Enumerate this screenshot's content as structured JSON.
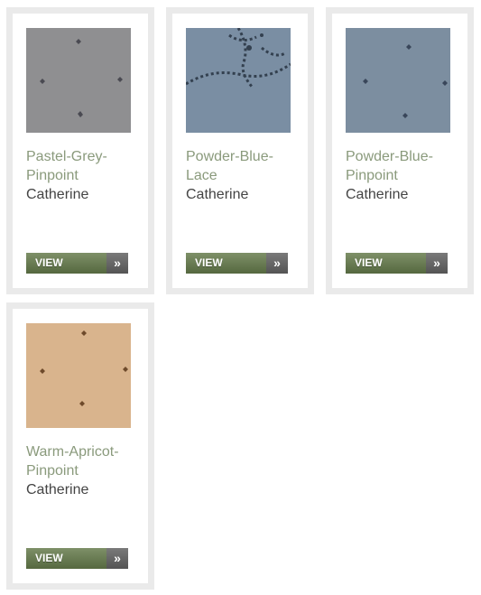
{
  "products": [
    {
      "name": "Pastel-Grey-Pinpoint",
      "collection": "Catherine",
      "button_label": "VIEW",
      "button_arrow": "»",
      "swatch": {
        "pattern": "pinpoint",
        "base": "#8a898c",
        "mark": "#4a4a52"
      }
    },
    {
      "name": "Powder-Blue-Lace",
      "collection": "Catherine",
      "button_label": "VIEW",
      "button_arrow": "»",
      "swatch": {
        "pattern": "lace",
        "base": "#7a8ea3",
        "mark": "#33404f"
      }
    },
    {
      "name": "Powder-Blue-Pinpoint",
      "collection": "Catherine",
      "button_label": "VIEW",
      "button_arrow": "»",
      "swatch": {
        "pattern": "pinpoint",
        "base": "#7c8ea0",
        "mark": "#39465a"
      }
    },
    {
      "name": "Warm-Apricot-Pinpoint",
      "collection": "Catherine",
      "button_label": "VIEW",
      "button_arrow": "»",
      "swatch": {
        "pattern": "pinpoint",
        "base": "#d9b48d",
        "mark": "#6e4a2b"
      }
    }
  ]
}
